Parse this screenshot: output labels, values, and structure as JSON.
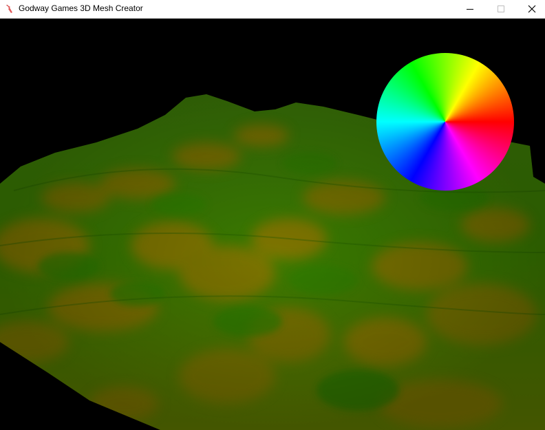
{
  "window": {
    "title": "Godway Games 3D Mesh Creator"
  },
  "titlebar_controls": {
    "minimize": "minimize-icon",
    "maximize": "maximize-icon",
    "close": "close-icon"
  },
  "scene": {
    "background_color": "#000000",
    "terrain_colors": {
      "green": "#2f7f00",
      "olive": "#7a7000",
      "dark_green": "#246400"
    },
    "widget": "color-wheel"
  }
}
